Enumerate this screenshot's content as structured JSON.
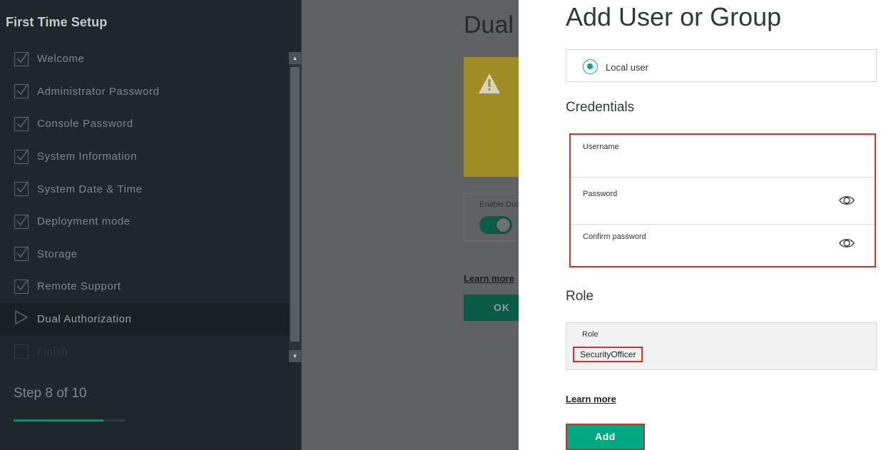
{
  "sidebar": {
    "title": "First Time Setup",
    "steps": [
      {
        "label": "Welcome",
        "state": "done"
      },
      {
        "label": "Administrator Password",
        "state": "done"
      },
      {
        "label": "Console Password",
        "state": "done"
      },
      {
        "label": "System Information",
        "state": "done"
      },
      {
        "label": "System Date & Time",
        "state": "done"
      },
      {
        "label": "Deployment mode",
        "state": "done"
      },
      {
        "label": "Storage",
        "state": "done"
      },
      {
        "label": "Remote Support",
        "state": "done"
      },
      {
        "label": "Dual Authorization",
        "state": "current"
      },
      {
        "label": "Finish",
        "state": "pending"
      }
    ],
    "step_counter": "Step 8 of 10",
    "progress_fraction": 0.8
  },
  "background_page": {
    "title": "Dual",
    "toggle_label": "Enable Dua",
    "toggle_on": true,
    "learn_more": "Learn more",
    "ok_button": "OK"
  },
  "drawer": {
    "title": "Add User or Group",
    "user_type_option": "Local user",
    "credentials_heading": "Credentials",
    "username_label": "Username",
    "password_label": "Password",
    "confirm_password_label": "Confirm password",
    "role_heading": "Role",
    "role_field_label": "Role",
    "role_value": "SecurityOfficer",
    "learn_more": "Learn more",
    "add_button": "Add"
  },
  "colors": {
    "accent": "#01a982",
    "highlight": "#d2332c",
    "sidebar_bg": "#1e282c"
  }
}
